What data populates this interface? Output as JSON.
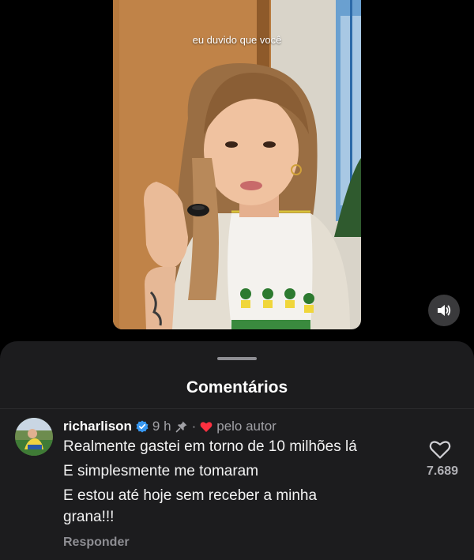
{
  "video": {
    "caption": "eu duvido que você",
    "mute_icon": "speaker-icon"
  },
  "sheet": {
    "title": "Comentários"
  },
  "comment": {
    "username": "richarlison",
    "verified_icon": "verified-badge-icon",
    "time": "9 h",
    "pin_icon": "pin-icon",
    "separator": "·",
    "liked_by_author_icon": "heart-icon",
    "liked_by_author": "pelo autor",
    "lines": [
      "Realmente gastei em torno de 10 milhões lá",
      "E simplesmente me tomaram",
      "E estou até hoje sem receber a minha",
      "grana!!!"
    ],
    "reply_label": "Responder",
    "like_count": "7.689"
  },
  "colors": {
    "sheet_bg": "#1c1c1e",
    "verified": "#3797f0",
    "heart_red": "#ff3040"
  }
}
